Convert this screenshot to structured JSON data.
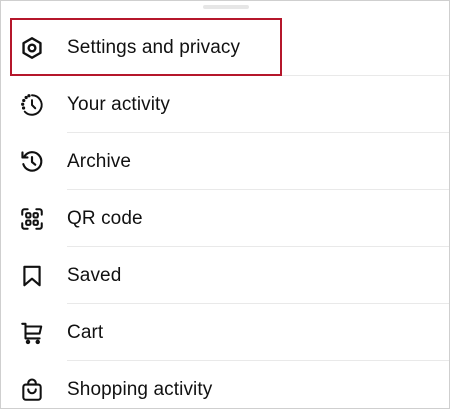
{
  "menu": {
    "items": [
      {
        "label": "Settings and privacy",
        "icon": "settings-gear-icon"
      },
      {
        "label": "Your activity",
        "icon": "activity-clock-icon"
      },
      {
        "label": "Archive",
        "icon": "archive-icon"
      },
      {
        "label": "QR code",
        "icon": "qr-code-icon"
      },
      {
        "label": "Saved",
        "icon": "bookmark-icon"
      },
      {
        "label": "Cart",
        "icon": "cart-icon"
      },
      {
        "label": "Shopping activity",
        "icon": "shopping-bag-icon"
      }
    ]
  },
  "highlight": {
    "color": "#b5162b",
    "target": "Settings and privacy"
  }
}
